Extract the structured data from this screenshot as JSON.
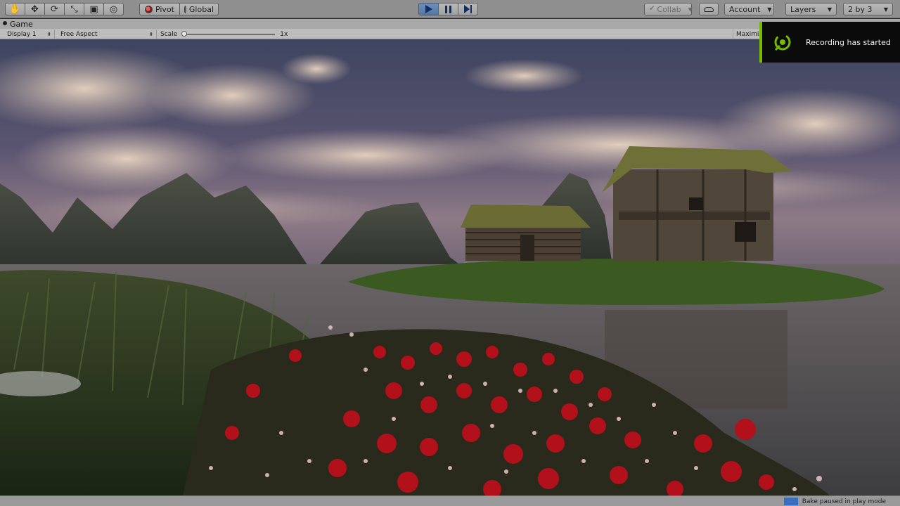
{
  "toolbar": {
    "pivot_label": "Pivot",
    "global_label": "Global",
    "collab_label": "Collab",
    "account_label": "Account",
    "layers_label": "Layers",
    "layout_label": "2 by 3",
    "tools": [
      "hand-tool",
      "move-tool",
      "rotate-tool",
      "scale-tool",
      "rect-tool",
      "transform-tool"
    ],
    "play_state": "playing"
  },
  "game_tab": {
    "title": "Game",
    "display": "Display 1",
    "aspect": "Free Aspect",
    "scale_label": "Scale",
    "scale_value": "1x",
    "scale_fraction": 0.0,
    "maximize_label": "Maximiz"
  },
  "recording": {
    "message": "Recording has started",
    "accent": "#76b900"
  },
  "status": {
    "message": "Bake paused in play mode"
  }
}
